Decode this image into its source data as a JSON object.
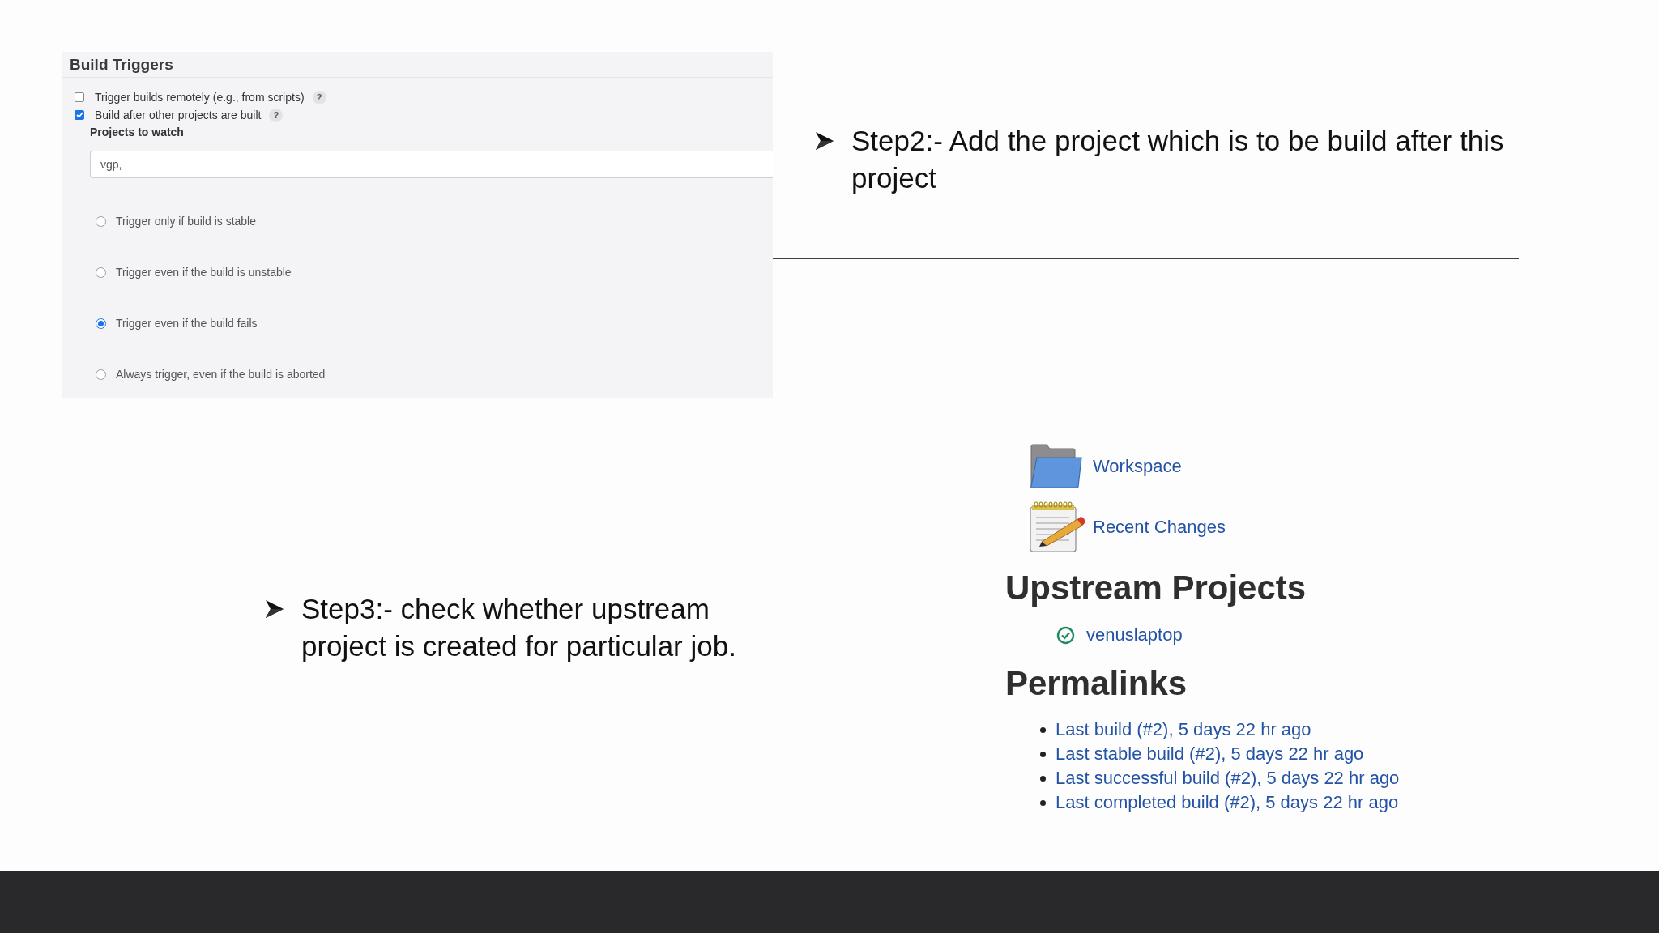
{
  "build_triggers": {
    "title": "Build Triggers",
    "options": [
      {
        "label": "Trigger builds remotely (e.g., from scripts)",
        "checked": false,
        "help": "?"
      },
      {
        "label": "Build after other projects are built",
        "checked": true,
        "help": "?"
      }
    ],
    "projects_to_watch": {
      "label": "Projects to watch",
      "value": "vgp,"
    },
    "trigger_conditions": [
      {
        "label": "Trigger only if build is stable",
        "selected": false
      },
      {
        "label": "Trigger even if the build is unstable",
        "selected": false
      },
      {
        "label": "Trigger even if the build fails",
        "selected": true
      },
      {
        "label": "Always trigger, even if the build is aborted",
        "selected": false
      }
    ]
  },
  "notes": [
    {
      "text": "Step2:- Add the project which is to be build after this project"
    },
    {
      "text": "Step3:- check whether upstream project is created for particular job."
    }
  ],
  "jenkins_page": {
    "tasks": [
      {
        "kind": "folder",
        "label": "Workspace"
      },
      {
        "kind": "notepad",
        "label": "Recent Changes"
      }
    ],
    "upstream": {
      "title": "Upstream Projects",
      "projects": [
        "venuslaptop"
      ]
    },
    "permalinks": {
      "title": "Permalinks",
      "links": [
        "Last build (#2), 5 days 22 hr ago",
        "Last stable build (#2), 5 days 22 hr ago",
        "Last successful build (#2), 5 days 22 hr ago",
        "Last completed build (#2), 5 days 22 hr ago"
      ]
    }
  }
}
